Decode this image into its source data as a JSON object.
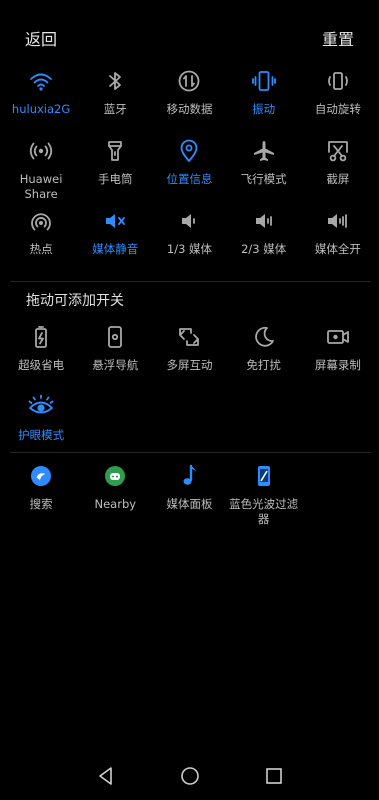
{
  "header": {
    "back_label": "返回",
    "reset_label": "重置"
  },
  "active_tiles": [
    {
      "label": "huluxia2G",
      "icon": "wifi-icon",
      "active": true
    },
    {
      "label": "蓝牙",
      "icon": "bluetooth-icon",
      "active": false
    },
    {
      "label": "移动数据",
      "icon": "mobile-data-icon",
      "active": false
    },
    {
      "label": "振动",
      "icon": "vibrate-icon",
      "active": true
    },
    {
      "label": "自动旋转",
      "icon": "auto-rotate-icon",
      "active": false
    },
    {
      "label": "Huawei Share",
      "icon": "huawei-share-icon",
      "active": false
    },
    {
      "label": "手电筒",
      "icon": "flashlight-icon",
      "active": false
    },
    {
      "label": "位置信息",
      "icon": "location-icon",
      "active": true
    },
    {
      "label": "飞行模式",
      "icon": "airplane-icon",
      "active": false
    },
    {
      "label": "截屏",
      "icon": "screenshot-icon",
      "active": false
    },
    {
      "label": "热点",
      "icon": "hotspot-icon",
      "active": false
    },
    {
      "label": "媒体静音",
      "icon": "media-mute-icon",
      "active": true
    },
    {
      "label": "1/3 媒体",
      "icon": "volume-one-third-icon",
      "active": false
    },
    {
      "label": "2/3 媒体",
      "icon": "volume-two-thirds-icon",
      "active": false
    },
    {
      "label": "媒体全开",
      "icon": "volume-full-icon",
      "active": false
    }
  ],
  "section_title": "拖动可添加开关",
  "available_tiles": [
    {
      "label": "超级省电",
      "icon": "power-saver-icon",
      "active": false
    },
    {
      "label": "悬浮导航",
      "icon": "floating-nav-icon",
      "active": false
    },
    {
      "label": "多屏互动",
      "icon": "multi-screen-icon",
      "active": false
    },
    {
      "label": "免打扰",
      "icon": "do-not-disturb-icon",
      "active": false
    },
    {
      "label": "屏幕录制",
      "icon": "screen-record-icon",
      "active": false
    },
    {
      "label": "护眼模式",
      "icon": "eye-comfort-icon",
      "active": true
    }
  ],
  "app_tiles": [
    {
      "label": "搜索",
      "icon": "search-app-icon",
      "active": false
    },
    {
      "label": "Nearby",
      "icon": "nearby-app-icon",
      "active": false
    },
    {
      "label": "媒体面板",
      "icon": "media-panel-icon",
      "active": false
    },
    {
      "label": "蓝色光波过滤器",
      "icon": "blue-light-filter-icon",
      "active": false
    }
  ],
  "navbar": {
    "back": "back-icon",
    "home": "home-icon",
    "recents": "recents-icon"
  },
  "colors": {
    "accent": "#2f8cff",
    "icon_gray": "#a8a8a8",
    "background": "#000000"
  }
}
